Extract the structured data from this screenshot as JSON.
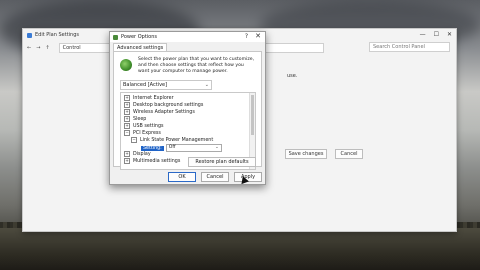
{
  "background_window": {
    "title": "Edit Plan Settings",
    "address": "Control",
    "search_placeholder": "Search Control Panel",
    "body_snippet": "use.",
    "save_changes": "Save changes",
    "cancel": "Cancel",
    "controls": [
      "—",
      "☐",
      "✕"
    ]
  },
  "dialog": {
    "title": "Power Options",
    "help": "?",
    "close": "✕",
    "tab": "Advanced settings",
    "description": "Select the power plan that you want to customize, and then choose settings that reflect how you want your computer to manage power.",
    "plan": "Balanced [Active]",
    "tree": {
      "items": [
        "Internet Explorer",
        "Desktop background settings",
        "Wireless Adapter Settings",
        "Sleep",
        "USB settings",
        "PCI Express",
        "Link State Power Management",
        "Display",
        "Multimedia settings"
      ],
      "expanders": [
        "+",
        "+",
        "+",
        "+",
        "+",
        "−",
        "−",
        "+",
        "+"
      ],
      "setting_label": "Setting:",
      "setting_value": "Off"
    },
    "restore": "Restore plan defaults",
    "ok": "OK",
    "cancel": "Cancel",
    "apply": "Apply"
  }
}
